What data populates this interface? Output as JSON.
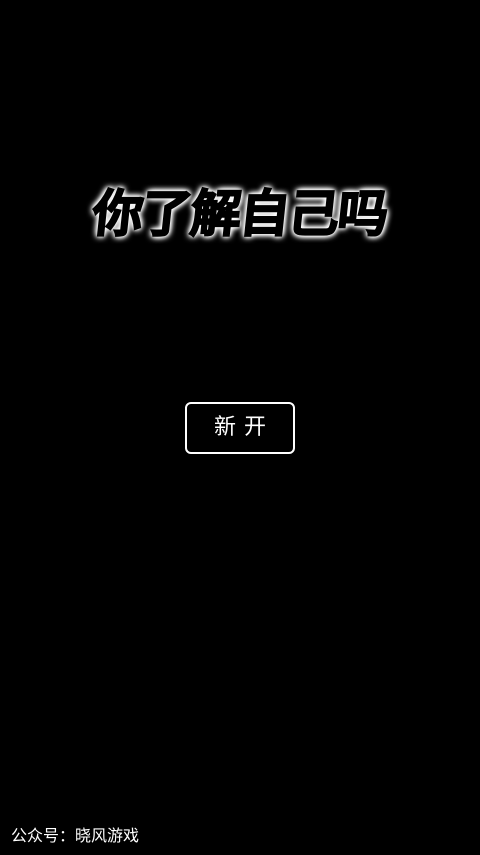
{
  "screen": {
    "background": "#000000"
  },
  "title": {
    "text": "你了解自己吗",
    "fill_color": "#000000",
    "outline_color": "#ffffff"
  },
  "menu": {
    "new_game_label": "新开",
    "button_border_color": "#ffffff"
  },
  "footer": {
    "credit": "公众号：晓风游戏"
  }
}
